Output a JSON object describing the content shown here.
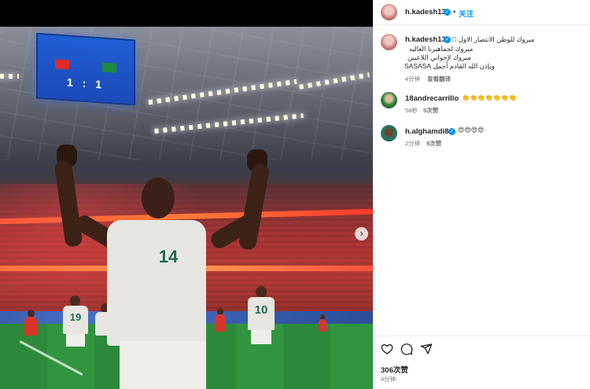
{
  "post": {
    "author": "h.kadesh13",
    "follow_label": "关注",
    "dot": "•",
    "more": "···",
    "caption": {
      "lines": [
        "مبروك للوطن الانتصار الاول 🏻",
        "مبروك لجماهيرنا الغاليه",
        "مبروك لإخواني اللاعبين",
        "وبإذن الله القادم أجمل SASASA"
      ],
      "time": "4分钟",
      "translate_label": "查看翻译"
    },
    "comments": [
      {
        "user": "18andrecarrillo",
        "text": "👏👏👏👏👏👏👏",
        "time": "58秒",
        "likes": "5次赞"
      },
      {
        "user": "h.alghamdi8",
        "text": "😍😍😍😍",
        "time": "2分钟",
        "likes": "9次赞"
      }
    ],
    "likes_count": "306次赞",
    "posted_time": "4分钟"
  },
  "photo": {
    "scoreboard": "1 : 1",
    "jersey_number": "14",
    "jersey_numbers_bg": [
      "19",
      "10"
    ]
  },
  "icons": {
    "like": "heart-outline-icon",
    "comment": "comment-bubble-icon",
    "share": "paper-plane-icon",
    "verified": "verified-badge-icon",
    "next": "chevron-right-icon"
  },
  "colors": {
    "accent": "#0095f6",
    "verified": "#0095f6",
    "text_primary": "#262626",
    "text_secondary": "#737373"
  }
}
